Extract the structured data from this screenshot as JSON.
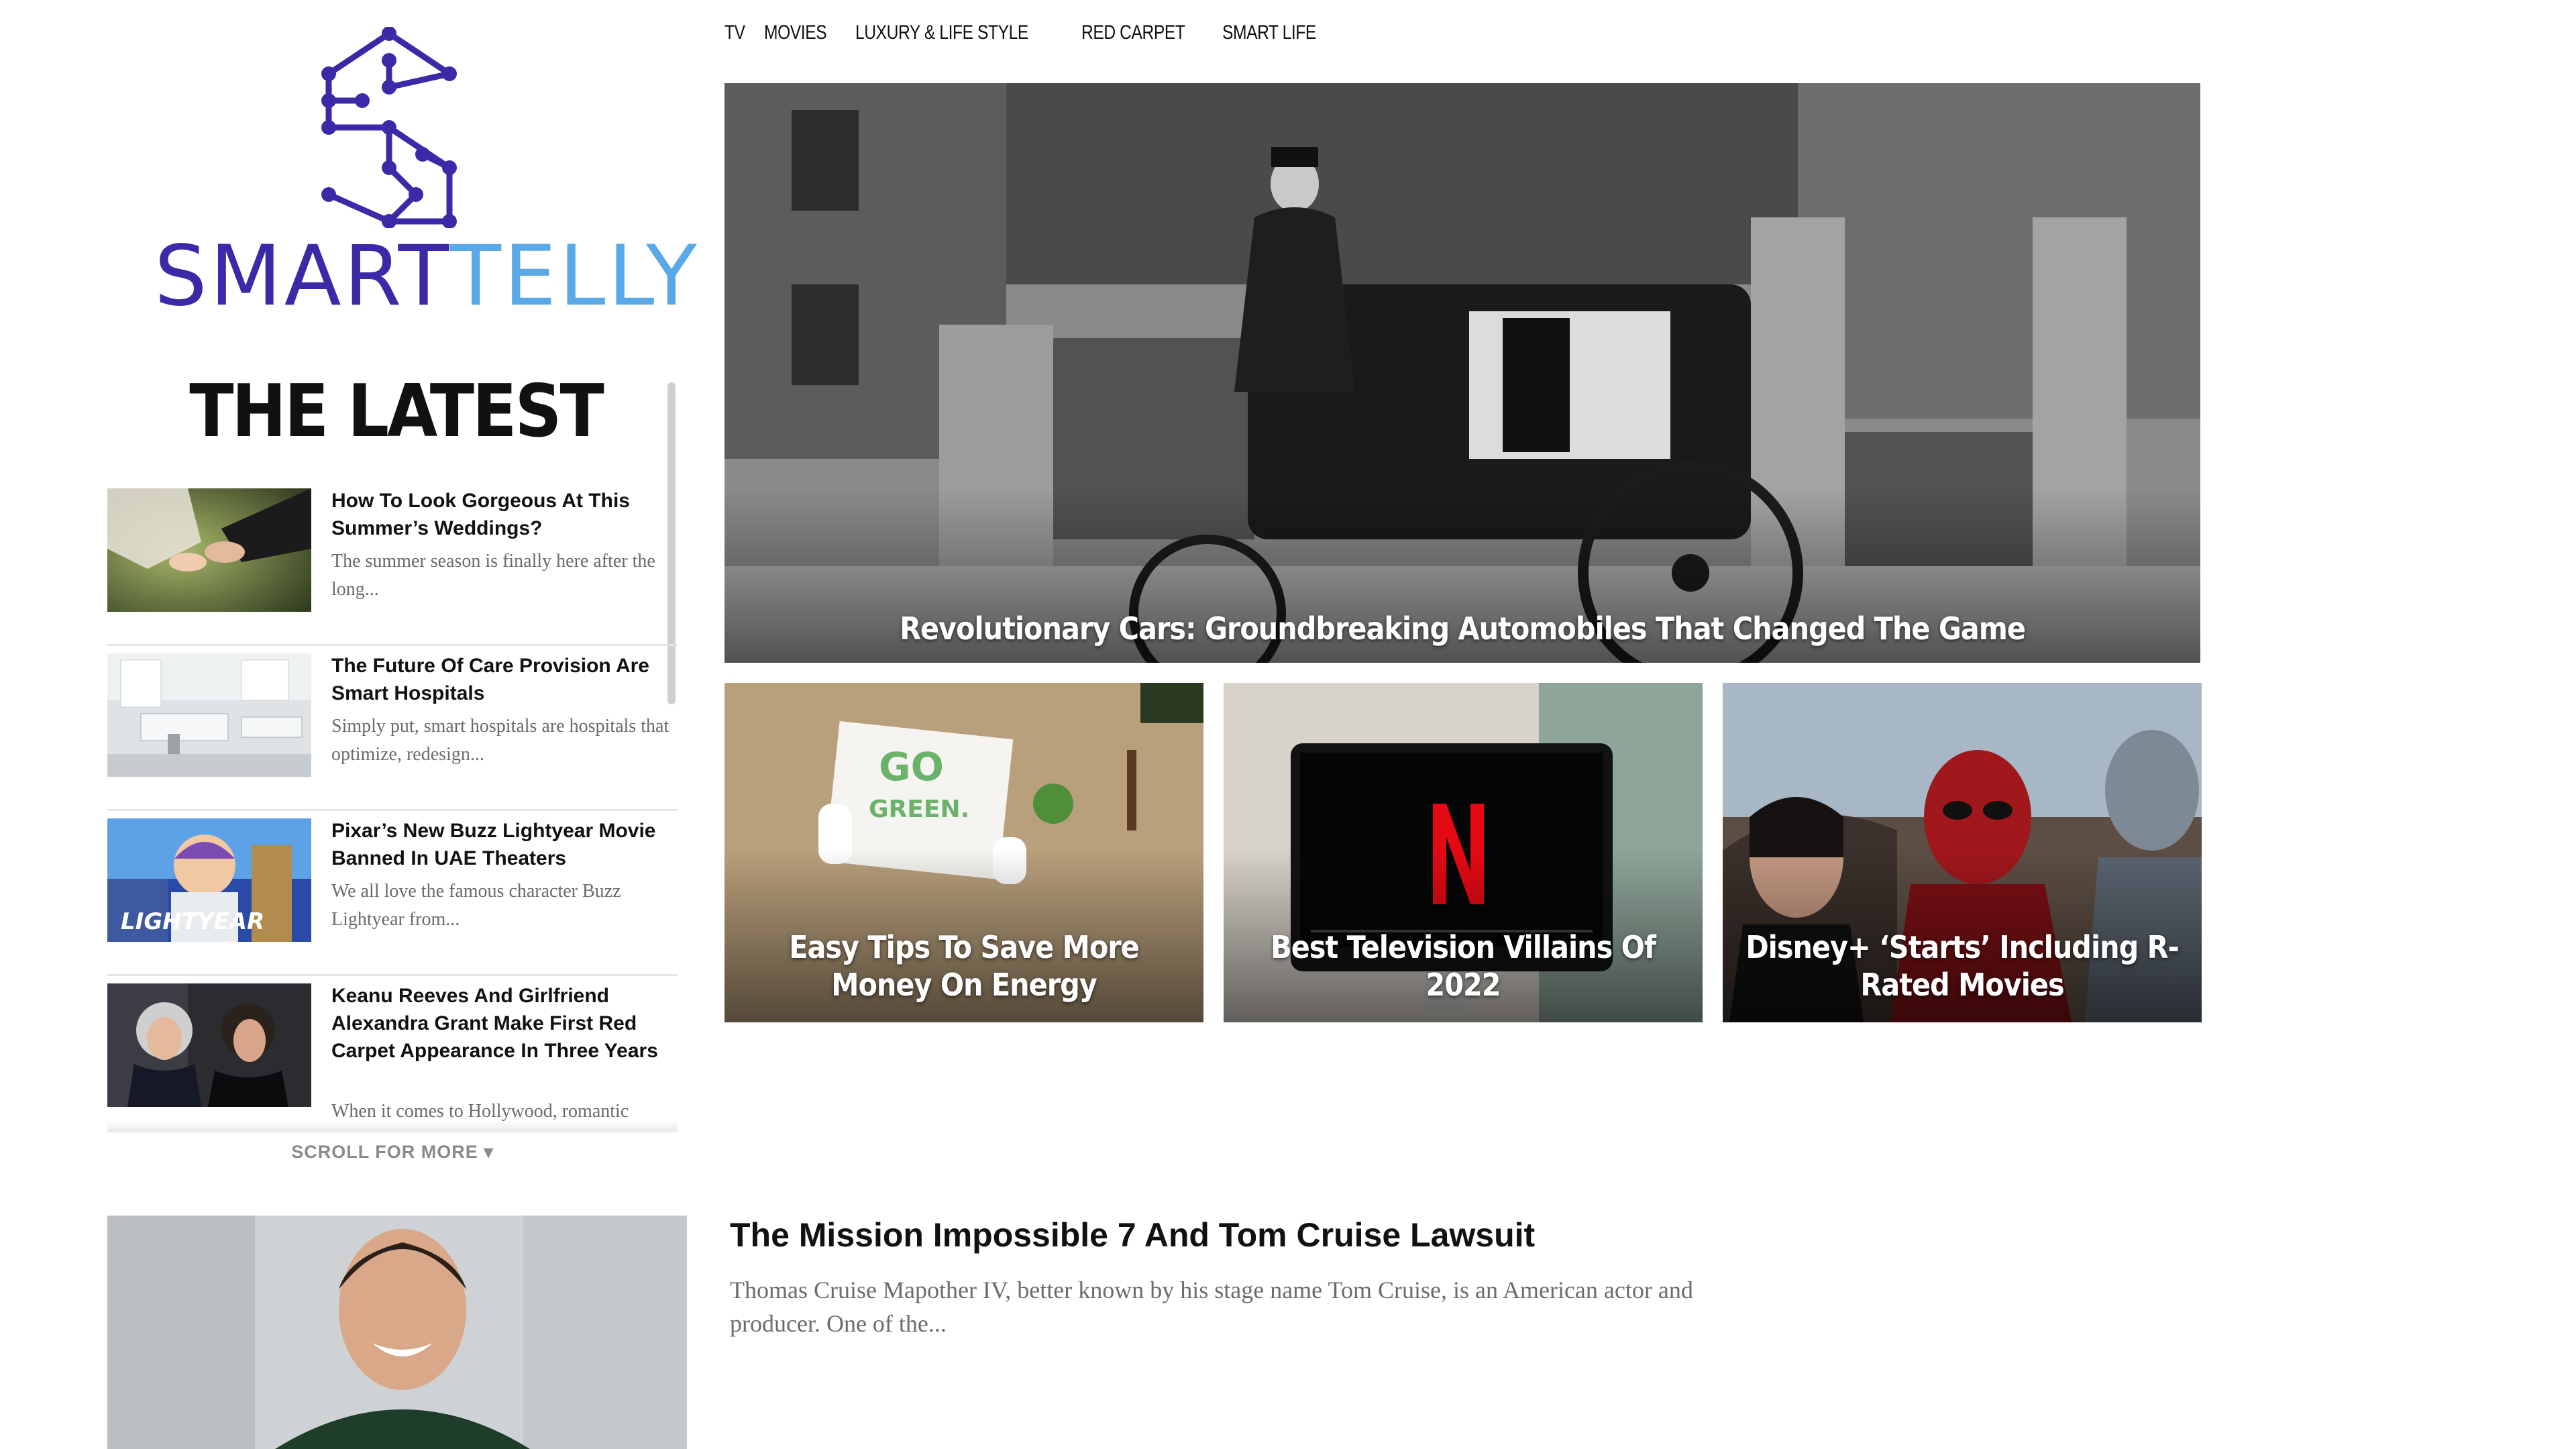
{
  "brand": {
    "name_part1": "SMART",
    "name_part2": "TELLY",
    "primary_color": "#3a2aa8",
    "secondary_color": "#5aa9e6"
  },
  "nav": {
    "items": [
      "TV",
      "MOVIES",
      "LUXURY & LIFE STYLE",
      "RED CARPET",
      "SMART LIFE"
    ]
  },
  "latest": {
    "heading": "THE LATEST",
    "items": [
      {
        "title": "How To Look Gorgeous At This Summer’s Weddings?",
        "excerpt": "The summer season is finally here after the long..."
      },
      {
        "title": "The Future Of Care Provision Are Smart Hospitals",
        "excerpt": "Simply put, smart hospitals are hospitals that optimize, redesign..."
      },
      {
        "title": "Pixar’s New Buzz Lightyear Movie Banned In UAE Theaters",
        "excerpt": "We all love the famous character Buzz Lightyear from...",
        "thumb_text": "LIGHTYEAR"
      },
      {
        "title": "Keanu Reeves And Girlfriend Alexandra Grant Make First Red Carpet Appearance In Three Years",
        "excerpt": "When it comes to Hollywood, romantic"
      }
    ],
    "scroll_label": "SCROLL FOR MORE ▾"
  },
  "hero": {
    "title": "Revolutionary Cars: Groundbreaking Automobiles That Changed The Game"
  },
  "cards": [
    {
      "title": "Easy Tips To Save More Money On Energy",
      "image_text": "GO GREEN."
    },
    {
      "title": "Best Television Villains Of 2022",
      "image_text": "N"
    },
    {
      "title": "Disney+ ‘Starts’ Including R-Rated Movies"
    }
  ],
  "bottom_article": {
    "title": "The Mission Impossible 7 And Tom Cruise Lawsuit",
    "excerpt": "Thomas Cruise Mapother IV, better known by his stage name Tom Cruise, is an American actor and producer. One of the..."
  }
}
